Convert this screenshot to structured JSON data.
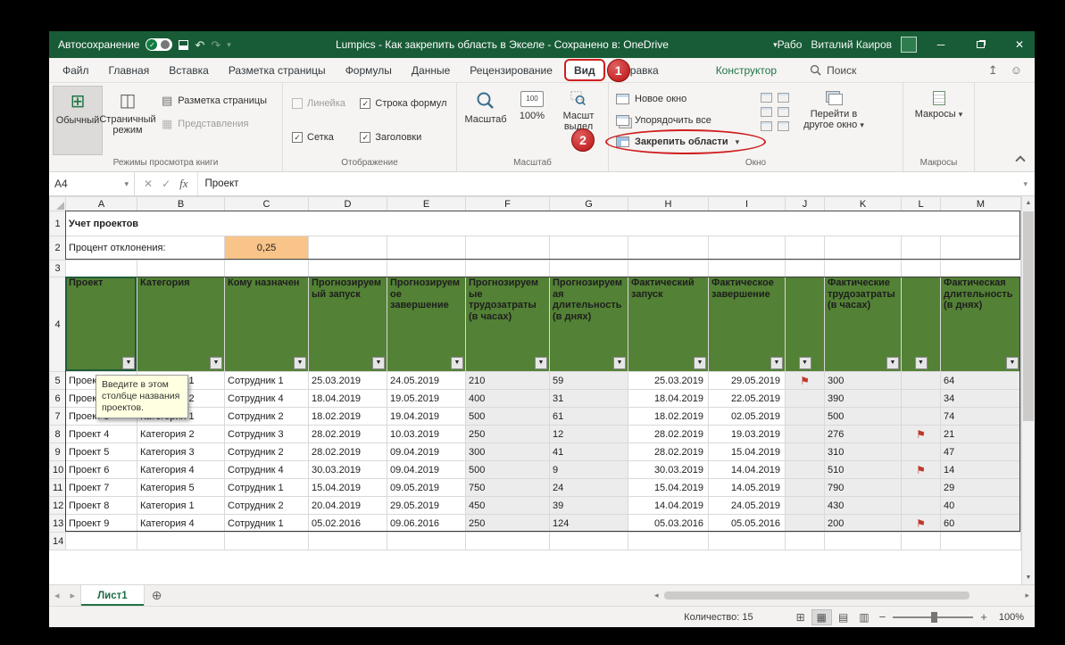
{
  "colors": {
    "excel_green": "#217346",
    "titlebar_green": "#185c37",
    "header_green": "#538135",
    "annotation_red": "#cf1f1f",
    "highlight_orange": "#f9c489"
  },
  "titlebar": {
    "autosave_label": "Автосохранение",
    "title": "Lumpics - Как закрепить область в Экселе - Сохранено в: OneDrive",
    "workbook_badge": "Рабо",
    "user_name": "Виталий Каиров"
  },
  "tab_row": {
    "tabs": [
      "Файл",
      "Главная",
      "Вставка",
      "Разметка страницы",
      "Формулы",
      "Данные",
      "Рецензирование",
      "Вид",
      "Справка",
      "Конструктор"
    ],
    "active_tab": "Вид",
    "search_label": "Поиск",
    "step1": "1"
  },
  "ribbon": {
    "views": {
      "label": "Режимы просмотра книги",
      "normal": "Обычный",
      "page_break": "Страничный режим",
      "page_layout": "Разметка страницы",
      "custom": "Представления"
    },
    "show": {
      "label": "Отображение",
      "ruler": "Линейка",
      "gridlines": "Сетка",
      "formula_bar": "Строка формул",
      "headings": "Заголовки"
    },
    "zoom": {
      "label": "Масштаб",
      "zoom": "Масштаб",
      "hundred": "100%",
      "selection_line1": "Масшт",
      "selection_line2": "выдел"
    },
    "window": {
      "label": "Окно",
      "new_window": "Новое окно",
      "arrange_all": "Упорядочить все",
      "freeze": "Закрепить области",
      "switch1": "Перейти в",
      "switch2": "другое окно",
      "step2": "2"
    },
    "macros": {
      "label": "Макросы",
      "button": "Макросы"
    }
  },
  "formula_bar": {
    "cell_ref": "A4",
    "fx": "fx",
    "value": "Проект"
  },
  "grid": {
    "column_letters": [
      "A",
      "B",
      "C",
      "D",
      "E",
      "F",
      "G",
      "H",
      "I",
      "J",
      "K",
      "L",
      "M"
    ],
    "title": "Учет проектов",
    "deviation_label": "Процент отклонения:",
    "deviation_value": "0,25",
    "headers": [
      "Проект",
      "Категория",
      "Кому назначен",
      "Прогнозируемый запуск",
      "Прогнозируемое завершение",
      "Прогнозируемые трудозатраты (в часах)",
      "Прогнозируемая длительность (в днях)",
      "Фактический запуск",
      "Фактическое завершение",
      "",
      "Фактические трудозатраты (в часах)",
      "",
      "Фактическая длительность (в днях)"
    ],
    "rows": [
      {
        "n": 5,
        "cells": [
          "Проект 1",
          "Категория 1",
          "Сотрудник 1",
          "25.03.2019",
          "24.05.2019",
          "210",
          "59",
          "25.03.2019",
          "29.05.2019",
          "⚑",
          "300",
          "",
          "64"
        ]
      },
      {
        "n": 6,
        "cells": [
          "Проект 2",
          "Категория 2",
          "Сотрудник 4",
          "18.04.2019",
          "19.05.2019",
          "400",
          "31",
          "18.04.2019",
          "22.05.2019",
          "",
          "390",
          "",
          "34"
        ]
      },
      {
        "n": 7,
        "cells": [
          "Проект 3",
          "Категория 1",
          "Сотрудник 2",
          "18.02.2019",
          "19.04.2019",
          "500",
          "61",
          "18.02.2019",
          "02.05.2019",
          "",
          "500",
          "",
          "74"
        ]
      },
      {
        "n": 8,
        "cells": [
          "Проект 4",
          "Категория 2",
          "Сотрудник 3",
          "28.02.2019",
          "10.03.2019",
          "250",
          "12",
          "28.02.2019",
          "19.03.2019",
          "",
          "276",
          "⚑",
          "21"
        ]
      },
      {
        "n": 9,
        "cells": [
          "Проект 5",
          "Категория 3",
          "Сотрудник 2",
          "28.02.2019",
          "09.04.2019",
          "300",
          "41",
          "28.02.2019",
          "15.04.2019",
          "",
          "310",
          "",
          "47"
        ]
      },
      {
        "n": 10,
        "cells": [
          "Проект 6",
          "Категория 4",
          "Сотрудник 4",
          "30.03.2019",
          "09.04.2019",
          "500",
          "9",
          "30.03.2019",
          "14.04.2019",
          "",
          "510",
          "⚑",
          "14"
        ]
      },
      {
        "n": 11,
        "cells": [
          "Проект 7",
          "Категория 5",
          "Сотрудник 1",
          "15.04.2019",
          "09.05.2019",
          "750",
          "24",
          "15.04.2019",
          "14.05.2019",
          "",
          "790",
          "",
          "29"
        ]
      },
      {
        "n": 12,
        "cells": [
          "Проект 8",
          "Категория 1",
          "Сотрудник 2",
          "20.04.2019",
          "29.05.2019",
          "450",
          "39",
          "14.04.2019",
          "24.05.2019",
          "",
          "430",
          "",
          "40"
        ]
      },
      {
        "n": 13,
        "cells": [
          "Проект 9",
          "Категория 4",
          "Сотрудник 1",
          "05.02.2016",
          "09.06.2016",
          "250",
          "124",
          "05.03.2016",
          "05.05.2016",
          "",
          "200",
          "⚑",
          "60"
        ]
      }
    ],
    "tooltip": "Введите в этом столбце названия проектов."
  },
  "sheet_tabs": {
    "sheet": "Лист1"
  },
  "status_bar": {
    "count": "Количество: 15",
    "zoom_value": "100%"
  }
}
